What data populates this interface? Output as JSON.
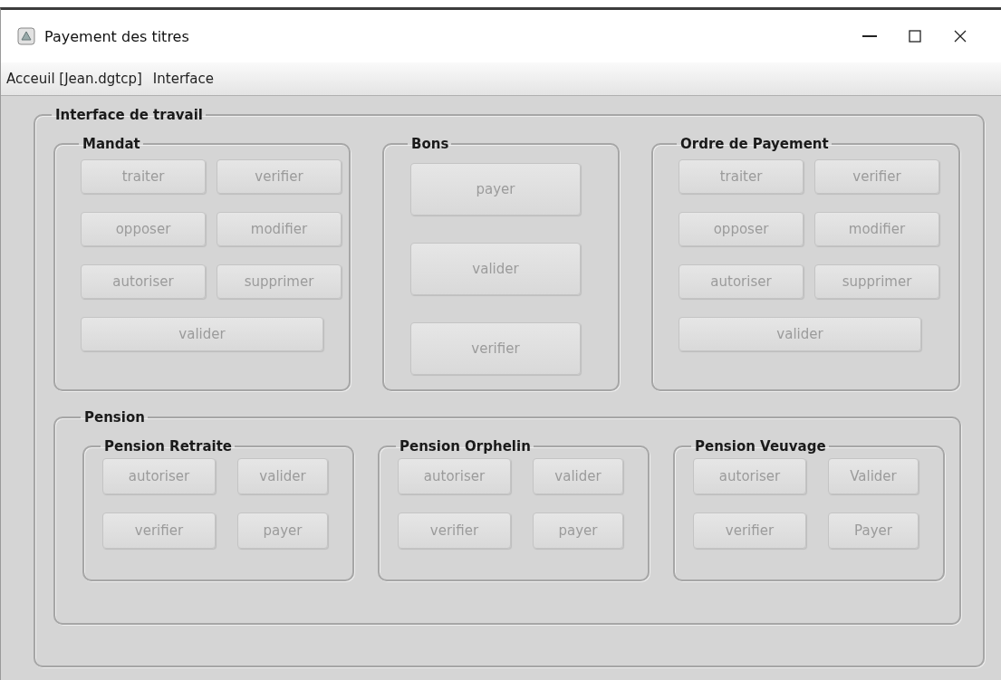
{
  "window": {
    "title": "Payement des titres"
  },
  "menu": [
    {
      "label": "Acceuil [Jean.dgtcp]"
    },
    {
      "label": "Interface"
    }
  ],
  "workspace": {
    "title": "Interface de travail",
    "groups": [
      {
        "title": "Mandat",
        "kind": "grid",
        "buttons": [
          {
            "label": "traiter",
            "disabled": true,
            "wide": false
          },
          {
            "label": "verifier",
            "disabled": true,
            "wide": false
          },
          {
            "label": "opposer",
            "disabled": true,
            "wide": false
          },
          {
            "label": "modifier",
            "disabled": true,
            "wide": false
          },
          {
            "label": "autoriser",
            "disabled": true,
            "wide": false
          },
          {
            "label": "supprimer",
            "disabled": true,
            "wide": false
          },
          {
            "label": "valider",
            "disabled": true,
            "wide": true
          }
        ]
      },
      {
        "title": "Bons",
        "kind": "column",
        "buttons": [
          {
            "label": "payer",
            "disabled": true,
            "wide": false
          },
          {
            "label": "valider",
            "disabled": true,
            "wide": false
          },
          {
            "label": "verifier",
            "disabled": true,
            "wide": false
          }
        ]
      },
      {
        "title": "Ordre de Payement",
        "kind": "grid",
        "buttons": [
          {
            "label": "traiter",
            "disabled": true,
            "wide": false
          },
          {
            "label": "verifier",
            "disabled": true,
            "wide": false
          },
          {
            "label": "opposer",
            "disabled": true,
            "wide": false
          },
          {
            "label": "modifier",
            "disabled": true,
            "wide": false
          },
          {
            "label": "autoriser",
            "disabled": true,
            "wide": false
          },
          {
            "label": "supprimer",
            "disabled": true,
            "wide": false
          },
          {
            "label": "valider",
            "disabled": true,
            "wide": true
          }
        ]
      }
    ],
    "pension": {
      "title": "Pension",
      "groups": [
        {
          "title": "Pension Retraite",
          "kind": "small",
          "buttons": [
            {
              "label": "autoriser",
              "disabled": true,
              "wide": false
            },
            {
              "label": "valider",
              "disabled": true,
              "wide": false
            },
            {
              "label": "verifier",
              "disabled": true,
              "wide": false
            },
            {
              "label": "payer",
              "disabled": true,
              "wide": false
            }
          ]
        },
        {
          "title": "Pension Orphelin",
          "kind": "small",
          "buttons": [
            {
              "label": "autoriser",
              "disabled": true,
              "wide": false
            },
            {
              "label": "valider",
              "disabled": true,
              "wide": false
            },
            {
              "label": "verifier",
              "disabled": true,
              "wide": false
            },
            {
              "label": "payer",
              "disabled": true,
              "wide": false
            }
          ]
        },
        {
          "title": "Pension Veuvage",
          "kind": "small",
          "buttons": [
            {
              "label": "autoriser",
              "disabled": true,
              "wide": false
            },
            {
              "label": "Valider",
              "disabled": true,
              "wide": false
            },
            {
              "label": "verifier",
              "disabled": true,
              "wide": false
            },
            {
              "label": "Payer",
              "disabled": true,
              "wide": false
            }
          ]
        }
      ]
    }
  }
}
